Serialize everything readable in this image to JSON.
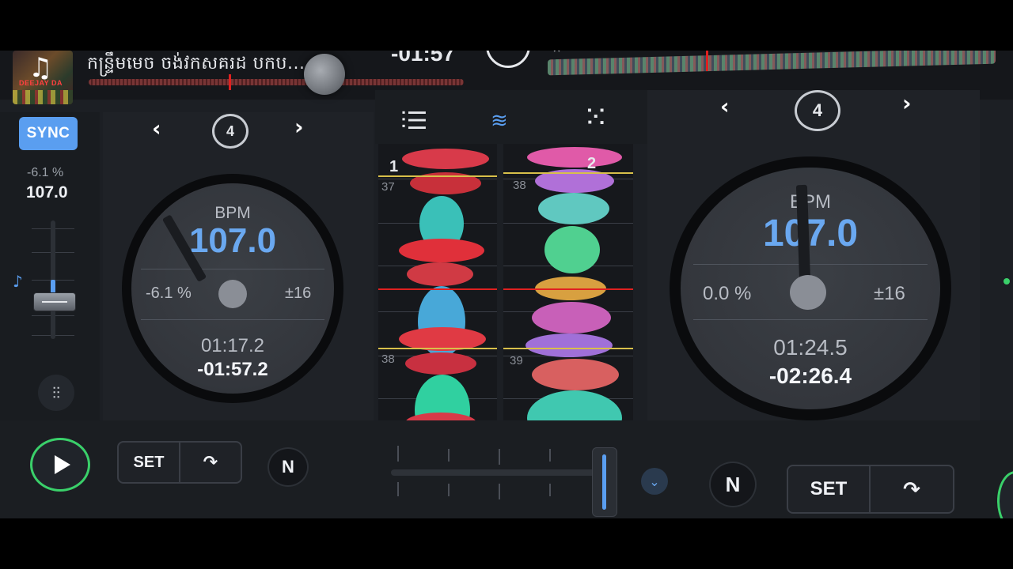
{
  "top": {
    "track_title": "កន្ទ្រឹមមេច ចង់វកសគរដ បក​ប...",
    "time_fragment": "-01:57",
    "cover_glyph": "♫",
    "cover_caption": "DEEJAY DA"
  },
  "deck_a": {
    "sync_label": "SYNC",
    "pitch_percent": "-6.1 %",
    "pitch_bpm": "107.0",
    "loop_size": "4",
    "bpm_label": "BPM",
    "bpm_value": "107.0",
    "pitch_display": "-6.1 %",
    "range": "±16",
    "elapsed": "01:17.2",
    "remaining": "-01:57.2",
    "nav_prev": "‹",
    "nav_next": "›"
  },
  "deck_b": {
    "loop_size": "4",
    "bpm_label": "BPM",
    "bpm_value": "107.0",
    "pitch_display": "0.0 %",
    "range": "±16",
    "elapsed": "01:24.5",
    "remaining": "-02:26.4",
    "nav_prev": "‹",
    "nav_next": "›"
  },
  "center": {
    "left_cue": "1",
    "right_cue": "2",
    "left_beats": [
      "37",
      "38"
    ],
    "right_beats": [
      "38",
      "39"
    ]
  },
  "bottom": {
    "set_label_a": "SET",
    "set_label_b": "SET",
    "n_label_a": "N",
    "n_label_b": "N"
  },
  "icons": {
    "sync": "sync-button",
    "play": "play-icon",
    "mixer": "mixer-icon",
    "waveform": "waveform-icon",
    "grid": "grid-icon",
    "eq": "eq-icon",
    "loop": "loop-icon",
    "cue_jump": "cue-jump-icon",
    "chevron_down": "chevron-down-icon"
  },
  "colors": {
    "accent_blue": "#5a9ef0",
    "bpm_blue": "#6aa8f0",
    "play_green": "#3ad06a",
    "playhead_red": "#e02020",
    "beat_yellow": "#d8c04a"
  }
}
